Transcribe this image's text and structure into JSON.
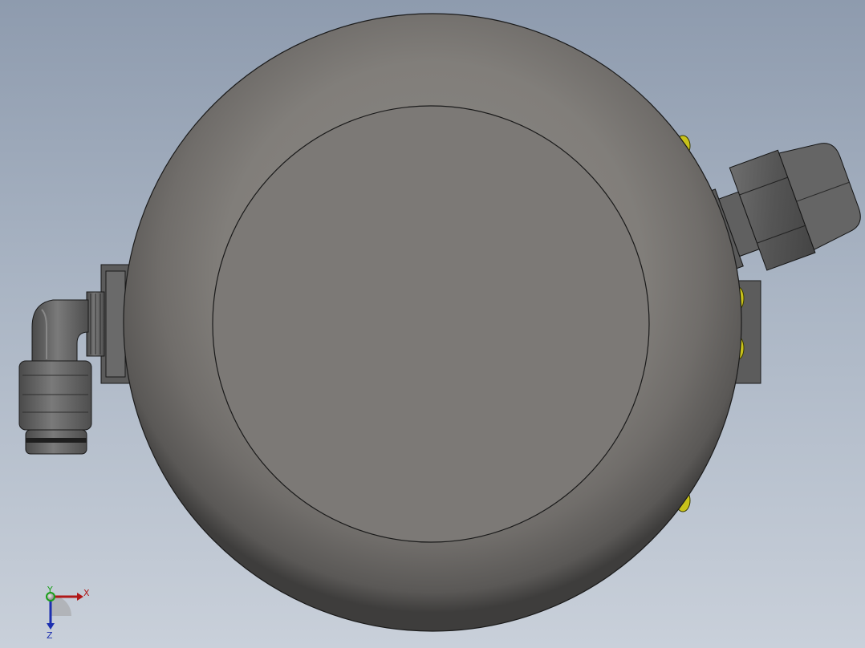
{
  "triad": {
    "x_label": "X",
    "y_label": "Y",
    "z_label": "Z",
    "x_color": "#b01818",
    "y_color": "#1aa01a",
    "z_color": "#1c2fb0"
  },
  "colors": {
    "background_top": "#8e9bae",
    "background_bottom": "#c9d0da",
    "body_gray": "#7a7875",
    "fitting_gray": "#5e5e5e",
    "screw_yellow": "#c8c21a"
  }
}
